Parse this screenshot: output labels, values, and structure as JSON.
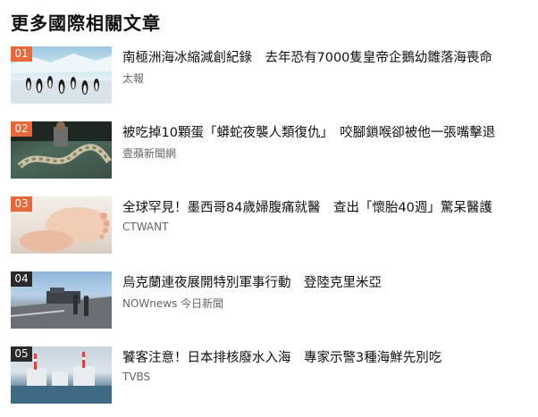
{
  "section": {
    "title": "更多國際相關文章"
  },
  "articles": [
    {
      "rank": "01",
      "title": "南極洲海冰縮減創紀錄　去年恐有7000隻皇帝企鵝幼雛落海喪命",
      "source": "太報"
    },
    {
      "rank": "02",
      "title": "被吃掉10顆蛋「蟒蛇夜襲人類復仇」　咬腳鎖喉卻被他一張嘴擊退",
      "source": "壹蘋新聞網"
    },
    {
      "rank": "03",
      "title": "全球罕見！墨西哥84歲婦腹痛就醫　查出「懷胎40週」驚呆醫護",
      "source": "CTWANT"
    },
    {
      "rank": "04",
      "title": "烏克蘭連夜展開特別軍事行動　登陸克里米亞",
      "source": "NOWnews 今日新聞"
    },
    {
      "rank": "05",
      "title": "饕客注意！日本排核廢水入海　專家示警3種海鮮先別吃",
      "source": "TVBS"
    }
  ],
  "colors": {
    "rank_hot": "#e8683a",
    "rank_normal": "#2b2b2b"
  }
}
